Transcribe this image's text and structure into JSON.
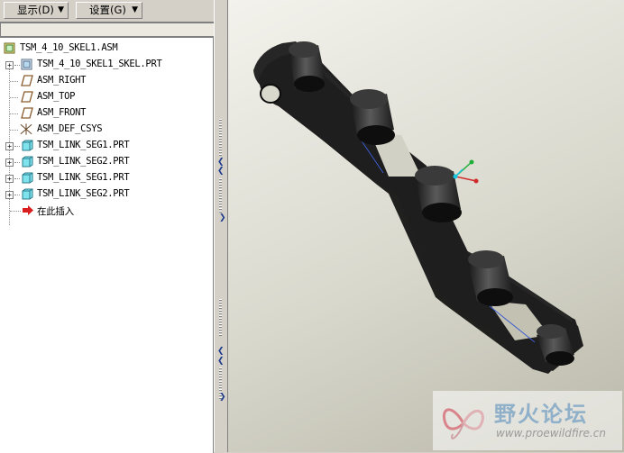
{
  "toolbar": {
    "show_menu": "显示(D)",
    "settings_menu": "设置(G)"
  },
  "model_tree": {
    "items": [
      {
        "label": "TSM_4_10_SKEL1.ASM",
        "icon": "assembly-icon",
        "expandable": false
      },
      {
        "label": "TSM_4_10_SKEL1_SKEL.PRT",
        "icon": "skeleton-part-icon",
        "expandable": true
      },
      {
        "label": "ASM_RIGHT",
        "icon": "datum-plane-icon",
        "expandable": false
      },
      {
        "label": "ASM_TOP",
        "icon": "datum-plane-icon",
        "expandable": false
      },
      {
        "label": "ASM_FRONT",
        "icon": "datum-plane-icon",
        "expandable": false
      },
      {
        "label": "ASM_DEF_CSYS",
        "icon": "coordinate-system-icon",
        "expandable": false
      },
      {
        "label": "TSM_LINK_SEG1.PRT",
        "icon": "part-icon",
        "expandable": true
      },
      {
        "label": "TSM_LINK_SEG2.PRT",
        "icon": "part-icon",
        "expandable": true
      },
      {
        "label": "TSM_LINK_SEG1.PRT",
        "icon": "part-icon",
        "expandable": true
      },
      {
        "label": "TSM_LINK_SEG2.PRT",
        "icon": "part-icon",
        "expandable": true
      },
      {
        "label": "在此插入",
        "icon": "insert-here-arrow-icon",
        "expandable": false
      }
    ]
  },
  "watermark": {
    "title": "野火论坛",
    "url": "www.proewildfire.cn"
  },
  "colors": {
    "panel": "#d4d0c8",
    "tree_bg": "#ffffff",
    "viewport_top": "#f3f2ec",
    "viewport_bottom": "#b9b8a9",
    "model": "#2a2a2a",
    "accent": "#1b3a8c"
  }
}
